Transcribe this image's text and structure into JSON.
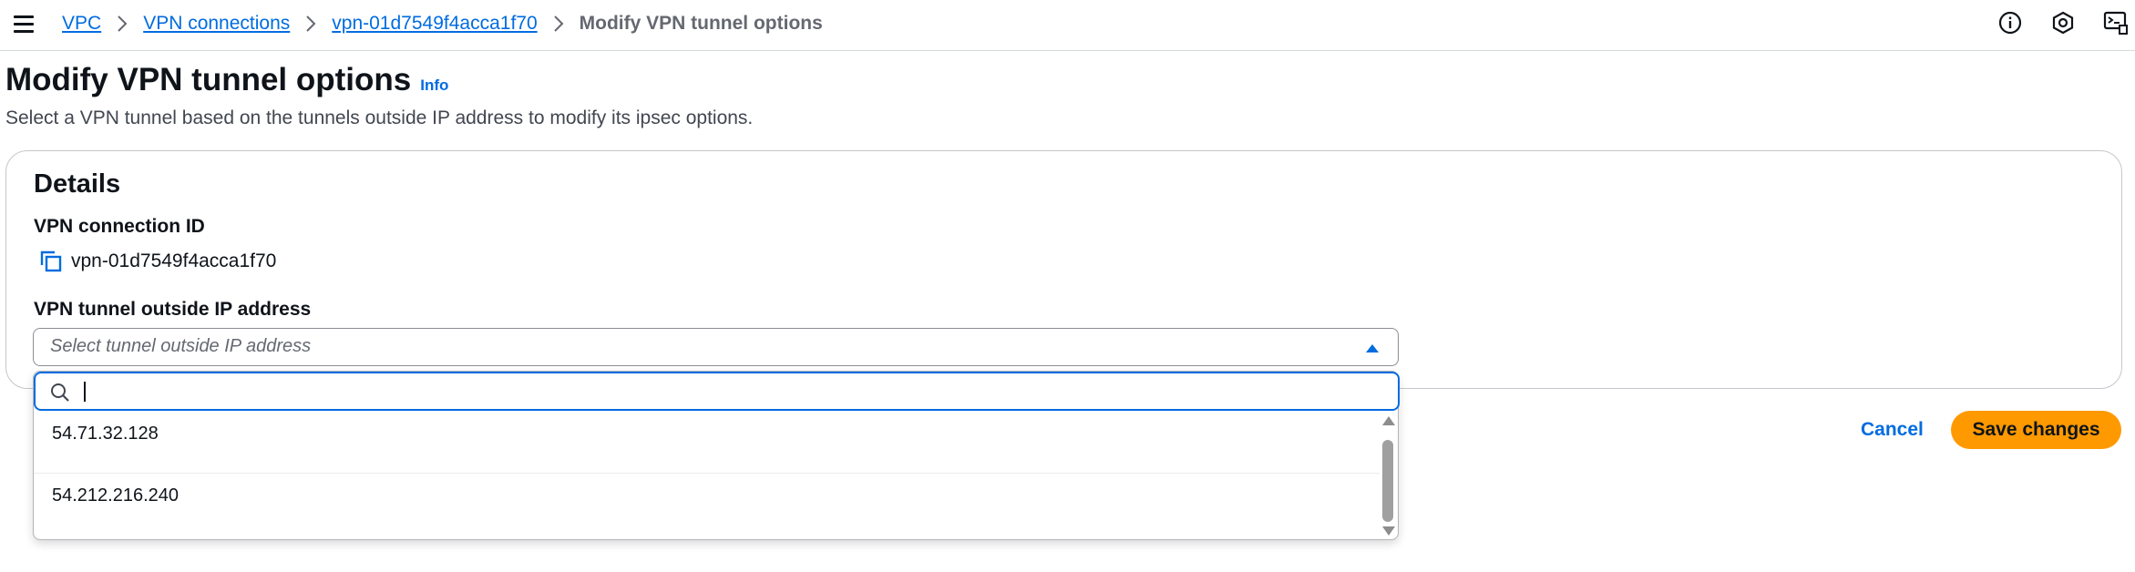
{
  "breadcrumbs": [
    {
      "label": "VPC"
    },
    {
      "label": "VPN connections"
    },
    {
      "label": "vpn-01d7549f4acca1f70"
    },
    {
      "label": "Modify VPN tunnel options"
    }
  ],
  "top_icons": [
    "info-circle-icon",
    "settings-hex-icon",
    "cloudshell-icon"
  ],
  "header": {
    "title": "Modify VPN tunnel options",
    "info_link": "Info",
    "description": "Select a VPN tunnel based on the tunnels outside IP address to modify its ipsec options."
  },
  "details": {
    "title": "Details",
    "connection_label": "VPN connection ID",
    "connection_id": "vpn-01d7549f4acca1f70",
    "tunnel_label": "VPN tunnel outside IP address",
    "select_placeholder": "Select tunnel outside IP address"
  },
  "dropdown": {
    "search_value": "",
    "options": [
      "54.71.32.128",
      "54.212.216.240"
    ]
  },
  "actions": {
    "cancel": "Cancel",
    "save": "Save changes"
  },
  "colors": {
    "link": "#006ce0",
    "primary_button": "#ff9900",
    "focus_border": "#006ce0"
  }
}
